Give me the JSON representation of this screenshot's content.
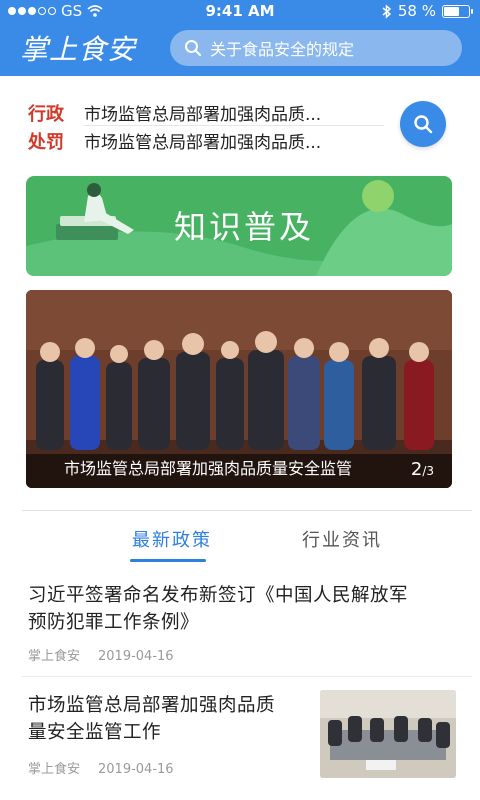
{
  "status": {
    "carrier": "GS",
    "time": "9:41 AM",
    "battery": "58 %",
    "battery_level": 0.58
  },
  "header": {
    "logo": "掌上食安",
    "search_placeholder": "关于食品安全的规定"
  },
  "penalties": [
    {
      "tag": "行政",
      "text": "市场监管总局部署加强肉品质..."
    },
    {
      "tag": "处罚",
      "text": "市场监管总局部署加强肉品质..."
    }
  ],
  "banner": {
    "title": "知识普及"
  },
  "carousel": {
    "caption": "市场监管总局部署加强肉品质量安全监管",
    "page_current": "2",
    "page_total": "/3"
  },
  "tabs": [
    {
      "label": "最新政策",
      "active": true
    },
    {
      "label": "行业资讯",
      "active": false
    }
  ],
  "news": [
    {
      "title_line1": "习近平签署命名发布新签订《中国人民解放军",
      "title_line2": "预防犯罪工作条例》",
      "source": "掌上食安",
      "date": "2019-04-16"
    },
    {
      "title_line1": "市场监管总局部署加强肉品质",
      "title_line2": "量安全监管工作",
      "source": "掌上食安",
      "date": "2019-04-16"
    }
  ],
  "colors": {
    "primary": "#3a8ae8",
    "tag_red": "#d13a2b",
    "banner_green": "#46b262"
  }
}
